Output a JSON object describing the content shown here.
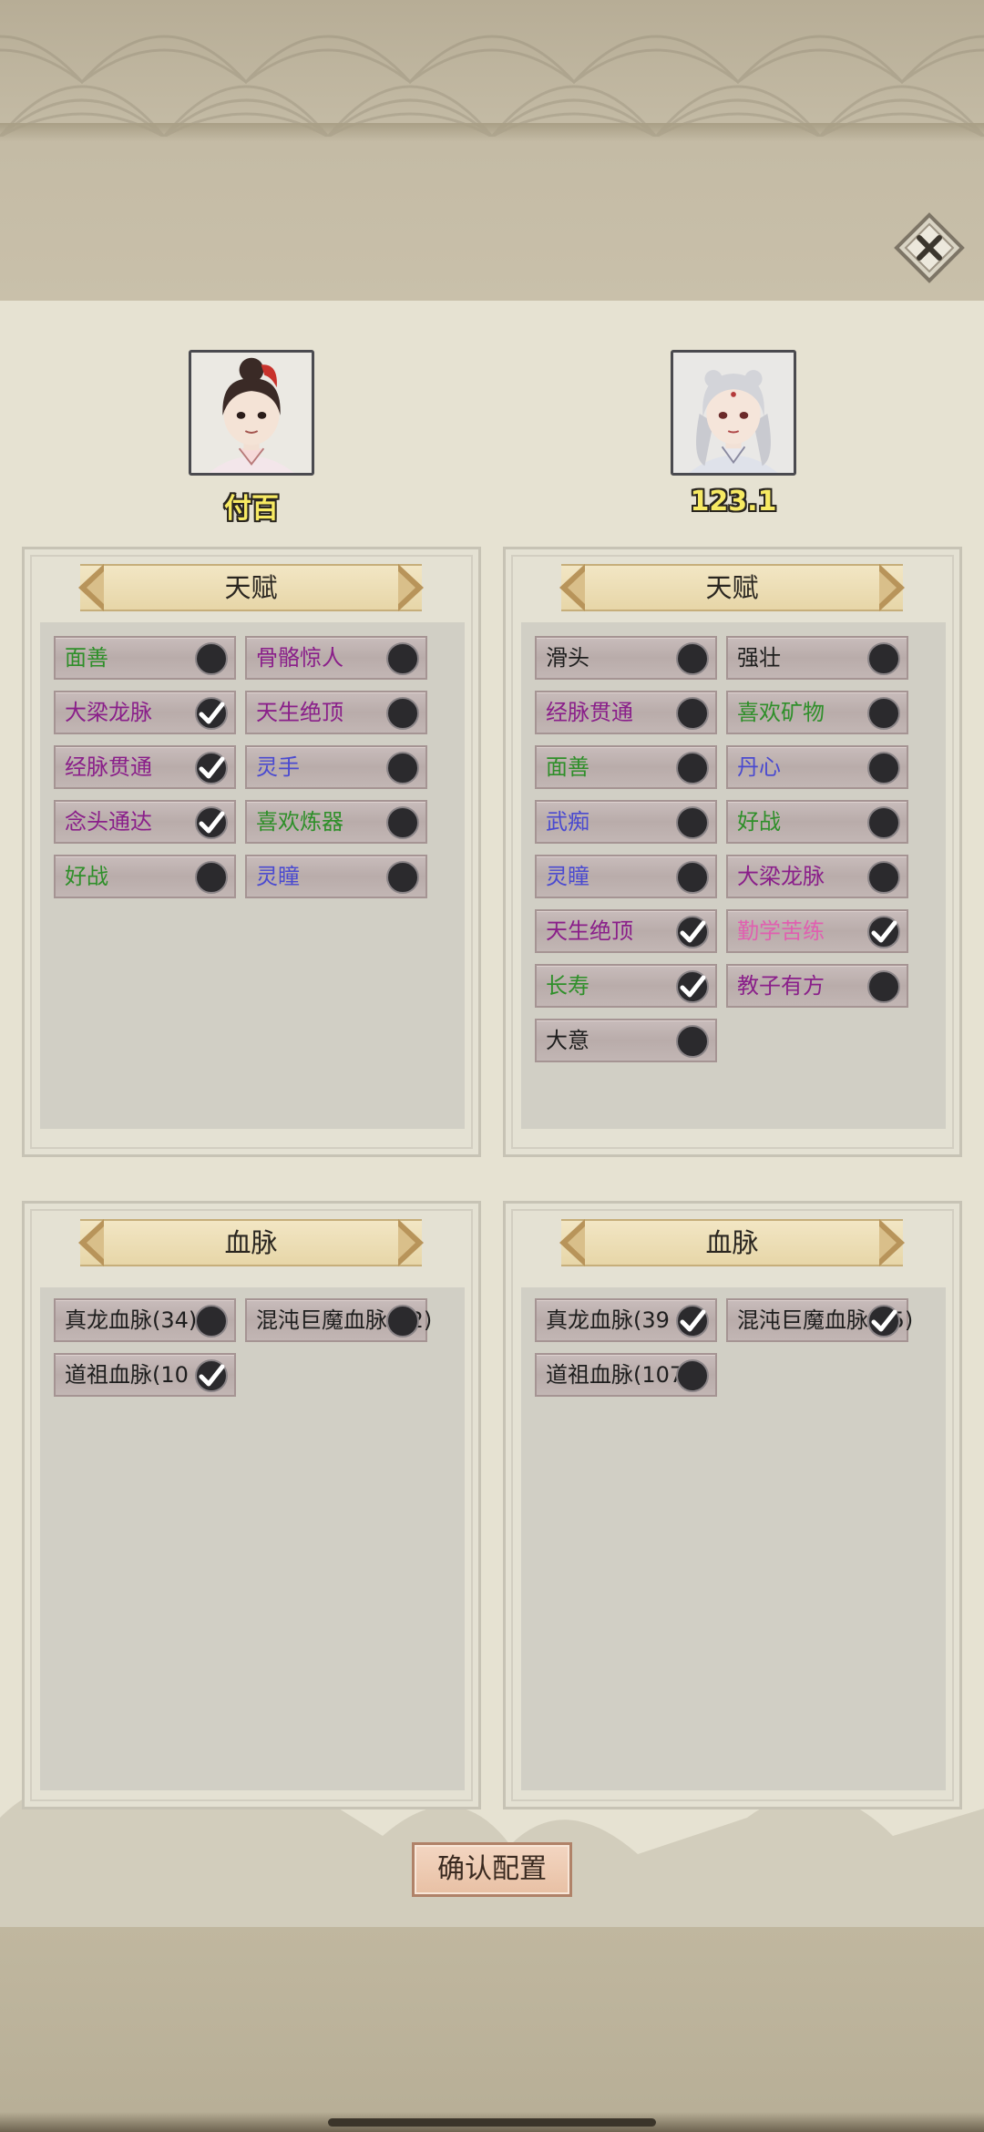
{
  "characters": {
    "left": {
      "name": "付百",
      "avatar_icon": "female-cultivator-avatar-icon"
    },
    "right": {
      "name": "123.1",
      "avatar_icon": "white-haired-cultivator-avatar-icon"
    }
  },
  "sections": {
    "talent_title": "天赋",
    "bloodline_title": "血脉"
  },
  "left_talents": [
    {
      "label": "面善",
      "checked": false,
      "color": "#2f8f2a"
    },
    {
      "label": "骨骼惊人",
      "checked": false,
      "color": "#8a1f8a"
    },
    {
      "label": "大梁龙脉",
      "checked": true,
      "color": "#8a1f8a"
    },
    {
      "label": "天生绝顶",
      "checked": false,
      "color": "#8a1f8a"
    },
    {
      "label": "经脉贯通",
      "checked": true,
      "color": "#8a1f8a"
    },
    {
      "label": "灵手",
      "checked": false,
      "color": "#4a4ad0"
    },
    {
      "label": "念头通达",
      "checked": true,
      "color": "#8a1f8a"
    },
    {
      "label": "喜欢炼器",
      "checked": false,
      "color": "#2f8f2a"
    },
    {
      "label": "好战",
      "checked": false,
      "color": "#2f8f2a"
    },
    {
      "label": "灵瞳",
      "checked": false,
      "color": "#4a4ad0"
    }
  ],
  "right_talents": [
    {
      "label": "滑头",
      "checked": false,
      "color": "#1e1e1e"
    },
    {
      "label": "强壮",
      "checked": false,
      "color": "#1e1e1e"
    },
    {
      "label": "经脉贯通",
      "checked": false,
      "color": "#8a1f8a"
    },
    {
      "label": "喜欢矿物",
      "checked": false,
      "color": "#2f8f2a"
    },
    {
      "label": "面善",
      "checked": false,
      "color": "#2f8f2a"
    },
    {
      "label": "丹心",
      "checked": false,
      "color": "#4a4ad0"
    },
    {
      "label": "武痴",
      "checked": false,
      "color": "#4a4ad0"
    },
    {
      "label": "好战",
      "checked": false,
      "color": "#2f8f2a"
    },
    {
      "label": "灵瞳",
      "checked": false,
      "color": "#4a4ad0"
    },
    {
      "label": "大梁龙脉",
      "checked": false,
      "color": "#8a1f8a"
    },
    {
      "label": "天生绝顶",
      "checked": true,
      "color": "#8a1f8a"
    },
    {
      "label": "勤学苦练",
      "checked": true,
      "color": "#e060b0"
    },
    {
      "label": "长寿",
      "checked": true,
      "color": "#2f8f2a"
    },
    {
      "label": "教子有方",
      "checked": false,
      "color": "#8a1f8a"
    },
    {
      "label": "大意",
      "checked": false,
      "color": "#1e1e1e"
    }
  ],
  "left_bloodlines": [
    {
      "label": "真龙血脉(34)",
      "checked": false
    },
    {
      "label": "混沌巨魔血脉(32)",
      "checked": false
    },
    {
      "label": "道祖血脉(10",
      "checked": true
    }
  ],
  "right_bloodlines": [
    {
      "label": "真龙血脉(39",
      "checked": true
    },
    {
      "label": "混沌巨魔血脉(35)",
      "checked": true
    },
    {
      "label": "道祖血脉(107)",
      "checked": false
    }
  ],
  "confirm_label": "确认配置"
}
